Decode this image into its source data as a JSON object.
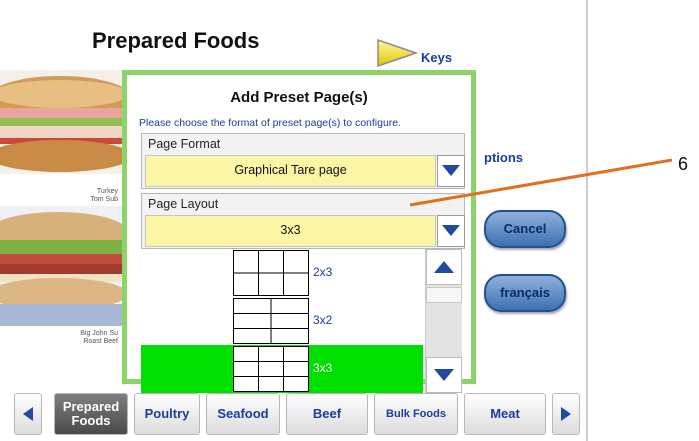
{
  "header": {
    "title": "Prepared Foods",
    "keys_label": "Keys"
  },
  "left_panel": {
    "items": [
      {
        "caption_line1": "Turkey",
        "caption_line2": "Tom Sub"
      },
      {
        "caption_line1": "Big John Su",
        "caption_line2": "Roast Beef"
      }
    ]
  },
  "right_panel": {
    "options_label": "ptions",
    "cancel_label": "Cancel",
    "french_label": "français"
  },
  "dialog": {
    "title": "Add Preset Page(s)",
    "instruction": "Please choose the format of preset page(s) to configure.",
    "page_format": {
      "label": "Page Format",
      "value": "Graphical Tare page"
    },
    "page_layout": {
      "label": "Page Layout",
      "value": "3x3",
      "options": [
        {
          "label": "2x3",
          "selected": false
        },
        {
          "label": "3x2",
          "selected": false
        },
        {
          "label": "3x3",
          "selected": true
        }
      ]
    }
  },
  "bottom_tabs": {
    "tabs": [
      {
        "label_line1": "Prepared",
        "label_line2": "Foods",
        "active": true
      },
      {
        "label_line1": "Poultry",
        "label_line2": "",
        "active": false
      },
      {
        "label_line1": "Seafood",
        "label_line2": "",
        "active": false
      },
      {
        "label_line1": "Beef",
        "label_line2": "",
        "active": false
      },
      {
        "label_line1": "Bulk Foods",
        "label_line2": "",
        "active": false
      },
      {
        "label_line1": "Meat",
        "label_line2": "",
        "active": false
      }
    ]
  },
  "annotation": {
    "callout_number": "6"
  },
  "colors": {
    "dialog_border": "#8cd36a",
    "select_bg": "#fbf6a6",
    "selected_row": "#00e000",
    "link_blue": "#1b3c9c",
    "callout_line": "#e07020"
  }
}
